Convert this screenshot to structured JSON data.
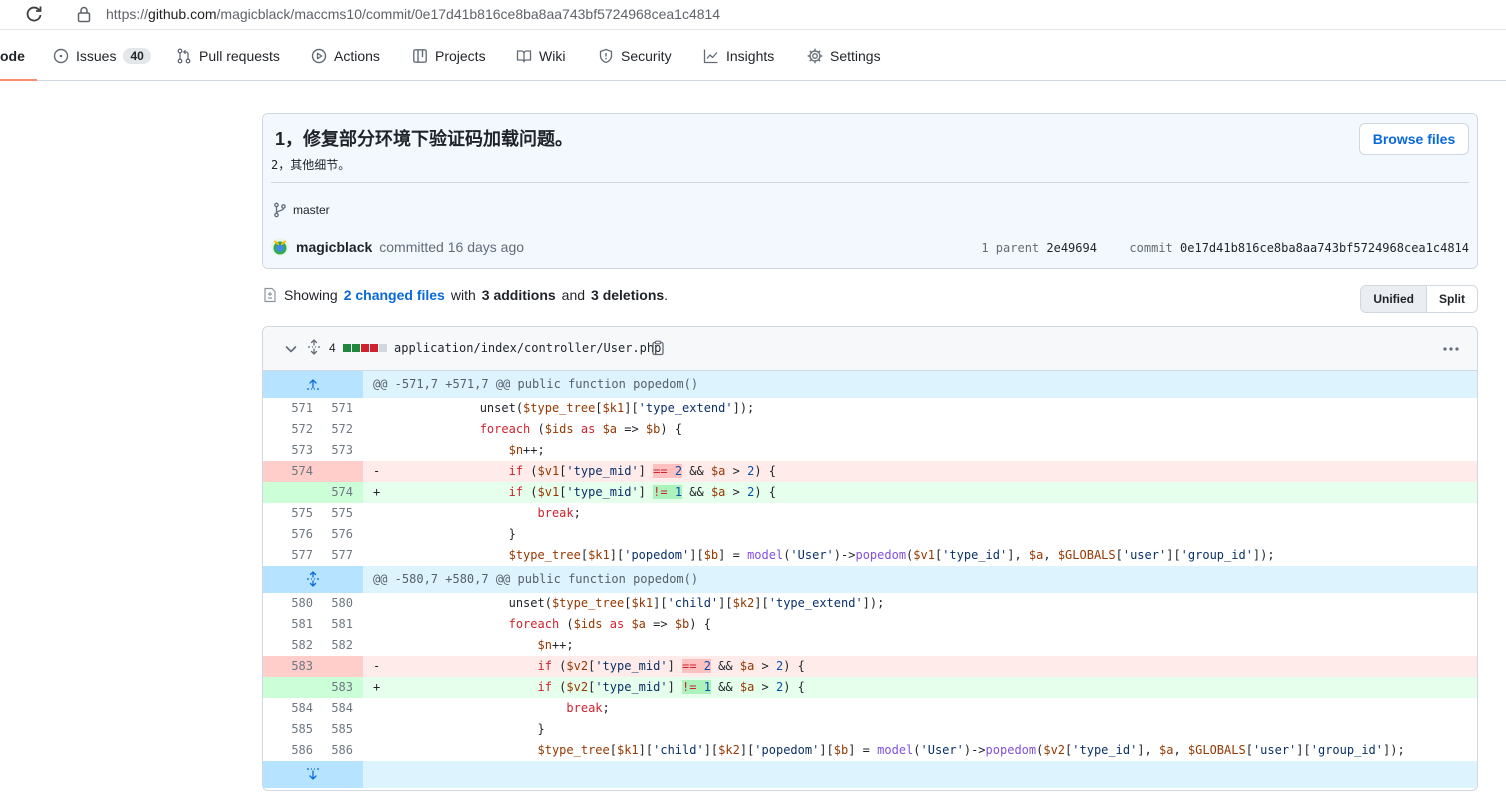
{
  "browser": {
    "url_prefix": "https://",
    "url_host": "github.com",
    "url_path": "/magicblack/maccms10/commit/0e17d41b816ce8ba8aa743bf5724968cea1c4814"
  },
  "nav": {
    "code": "ode",
    "issues": "Issues",
    "issues_count": "40",
    "pull_requests": "Pull requests",
    "actions": "Actions",
    "projects": "Projects",
    "wiki": "Wiki",
    "security": "Security",
    "insights": "Insights",
    "settings": "Settings"
  },
  "commit": {
    "title": "1，修复部分环境下验证码加载问题。",
    "description": "2，其他细节。",
    "browse_files": "Browse files",
    "branch": "master",
    "author": "magicblack",
    "committed_text": "committed 16 days ago",
    "parent_label": "1 parent",
    "parent_sha": "2e49694",
    "commit_label": "commit",
    "commit_sha": "0e17d41b816ce8ba8aa743bf5724968cea1c4814"
  },
  "summary": {
    "showing": "Showing",
    "changed_files": "2 changed files",
    "with": "with",
    "additions": "3 additions",
    "and": "and",
    "deletions": "3 deletions",
    "period": ".",
    "unified": "Unified",
    "split": "Split"
  },
  "file": {
    "count": "4",
    "path": "application/index/controller/User.php",
    "colors": {
      "add": "#1f883d",
      "del": "#cf222e",
      "neutral": "#d0d7de"
    },
    "diffstat": [
      "add",
      "add",
      "del",
      "del",
      "neutral"
    ],
    "hunk1": "@@ -571,7 +571,7 @@ public function popedom()",
    "hunk2": "@@ -580,7 +580,7 @@ public function popedom()",
    "lines": {
      "l571": {
        "old": "571",
        "new": "571"
      },
      "l572": {
        "old": "572",
        "new": "572"
      },
      "l573": {
        "old": "573",
        "new": "573"
      },
      "l574d": {
        "old": "574",
        "sign": "-"
      },
      "l574a": {
        "new": "574",
        "sign": "+"
      },
      "l575": {
        "old": "575",
        "new": "575"
      },
      "l576": {
        "old": "576",
        "new": "576"
      },
      "l577": {
        "old": "577",
        "new": "577"
      },
      "l580": {
        "old": "580",
        "new": "580"
      },
      "l581": {
        "old": "581",
        "new": "581"
      },
      "l582": {
        "old": "582",
        "new": "582"
      },
      "l583d": {
        "old": "583",
        "sign": "-"
      },
      "l583a": {
        "new": "583",
        "sign": "+"
      },
      "l584": {
        "old": "584",
        "new": "584"
      },
      "l585": {
        "old": "585",
        "new": "585"
      },
      "l586": {
        "old": "586",
        "new": "586"
      }
    }
  }
}
